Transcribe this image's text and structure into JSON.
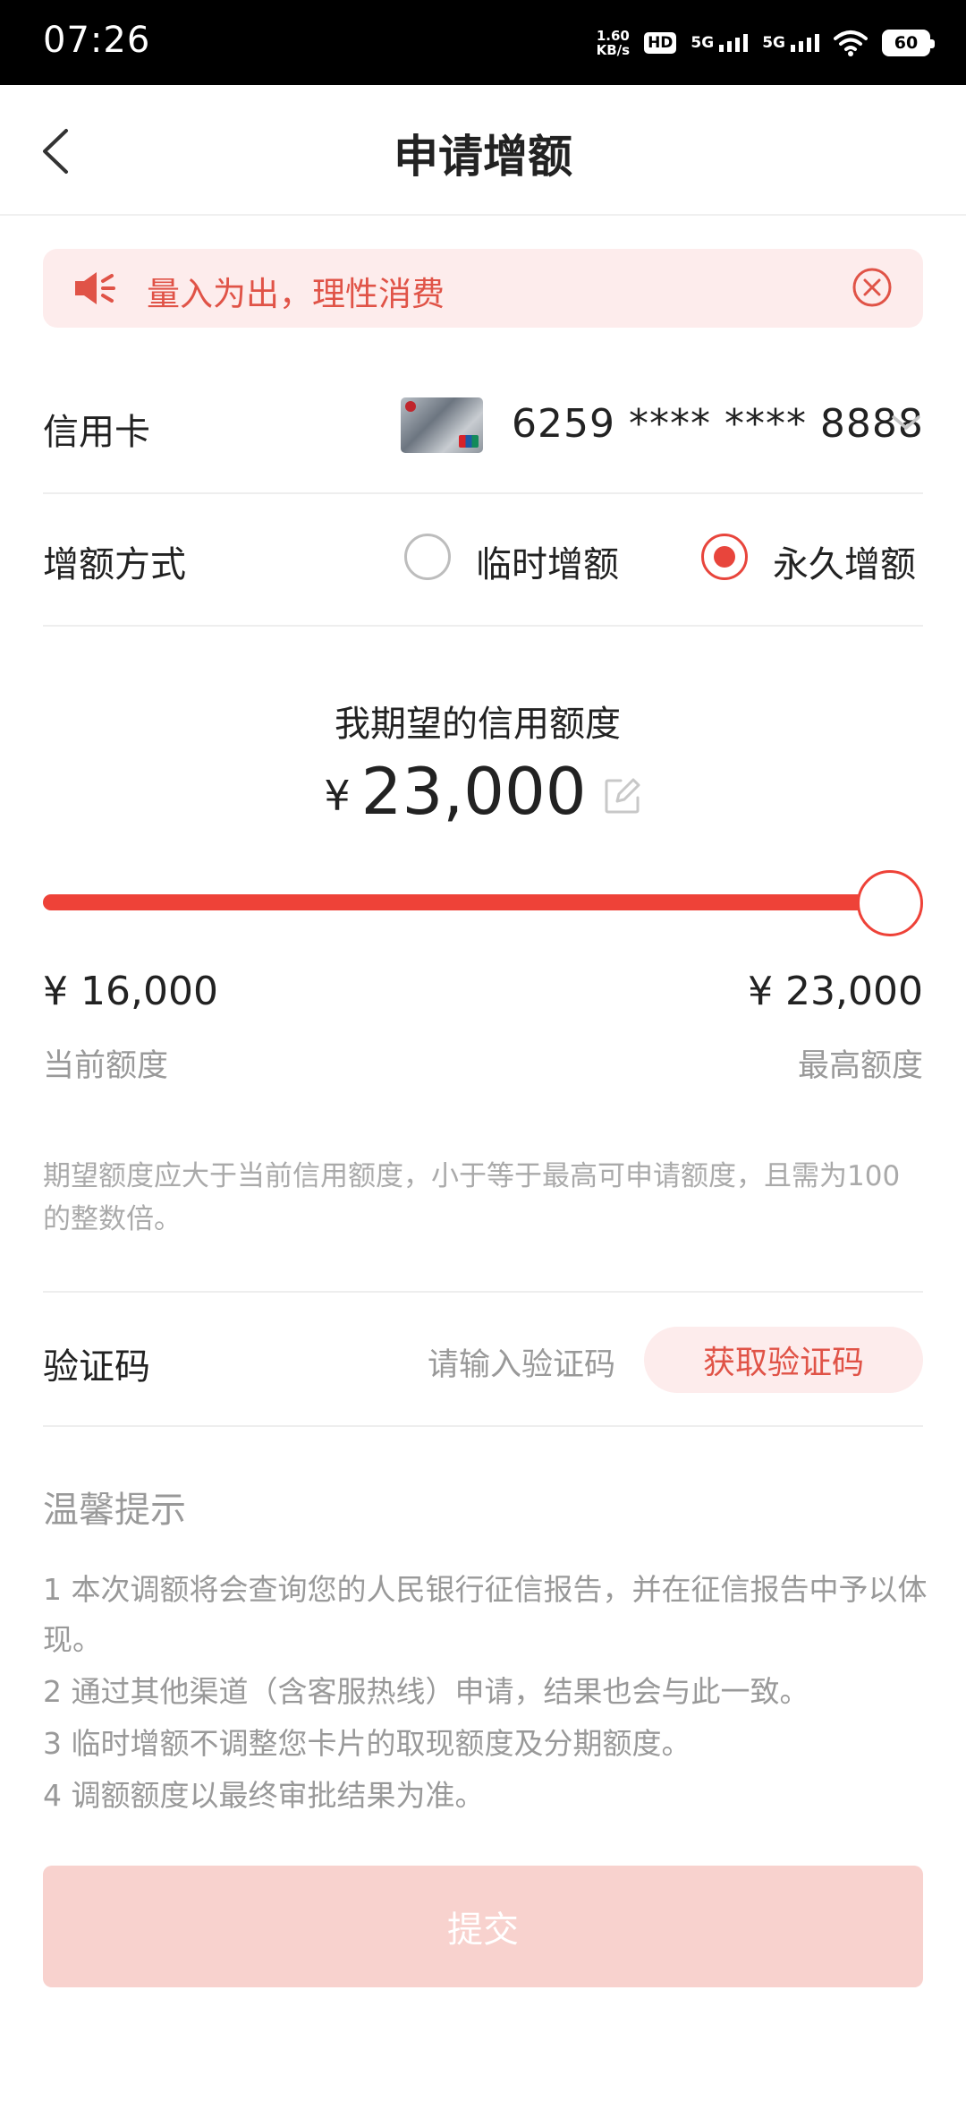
{
  "status_bar": {
    "time": "07:26",
    "net_speed_value": "1.60",
    "net_speed_unit": "KB/s",
    "hd_label": "HD",
    "signal_1_label": "5G",
    "signal_2_label": "5G",
    "battery": "60"
  },
  "header": {
    "title": "申请增额"
  },
  "notice": {
    "text": "量入为出，理性消费"
  },
  "card_row": {
    "label": "信用卡",
    "card_number": "6259 **** **** 8888"
  },
  "method_row": {
    "label": "增额方式",
    "options": [
      {
        "label": "临时增额",
        "checked": false
      },
      {
        "label": "永久增额",
        "checked": true
      }
    ]
  },
  "amount": {
    "title": "我期望的信用额度",
    "currency": "¥",
    "value": "23,000",
    "slider_fraction": 1.0
  },
  "limits": {
    "current_value": "¥ 16,000",
    "current_label": "当前额度",
    "max_value": "¥ 23,000",
    "max_label": "最高额度"
  },
  "hint": "期望额度应大于当前信用额度，小于等于最高可申请额度，且需为100的整数倍。",
  "verification": {
    "label": "验证码",
    "placeholder": "请输入验证码",
    "button": "获取验证码"
  },
  "tips": {
    "title": "温馨提示",
    "items": [
      "1  本次调额将会查询您的人民银行征信报告，并在征信报告中予以体现。",
      "2  通过其他渠道（含客服热线）申请，结果也会与此一致。",
      "3  临时增额不调整您卡片的取现额度及分期额度。",
      "4  调额额度以最终审批结果为准。"
    ]
  },
  "submit_label": "提交",
  "colors": {
    "accent": "#ee4238",
    "notice_bg": "#fdecec",
    "submit_disabled": "#f8d2ce"
  }
}
